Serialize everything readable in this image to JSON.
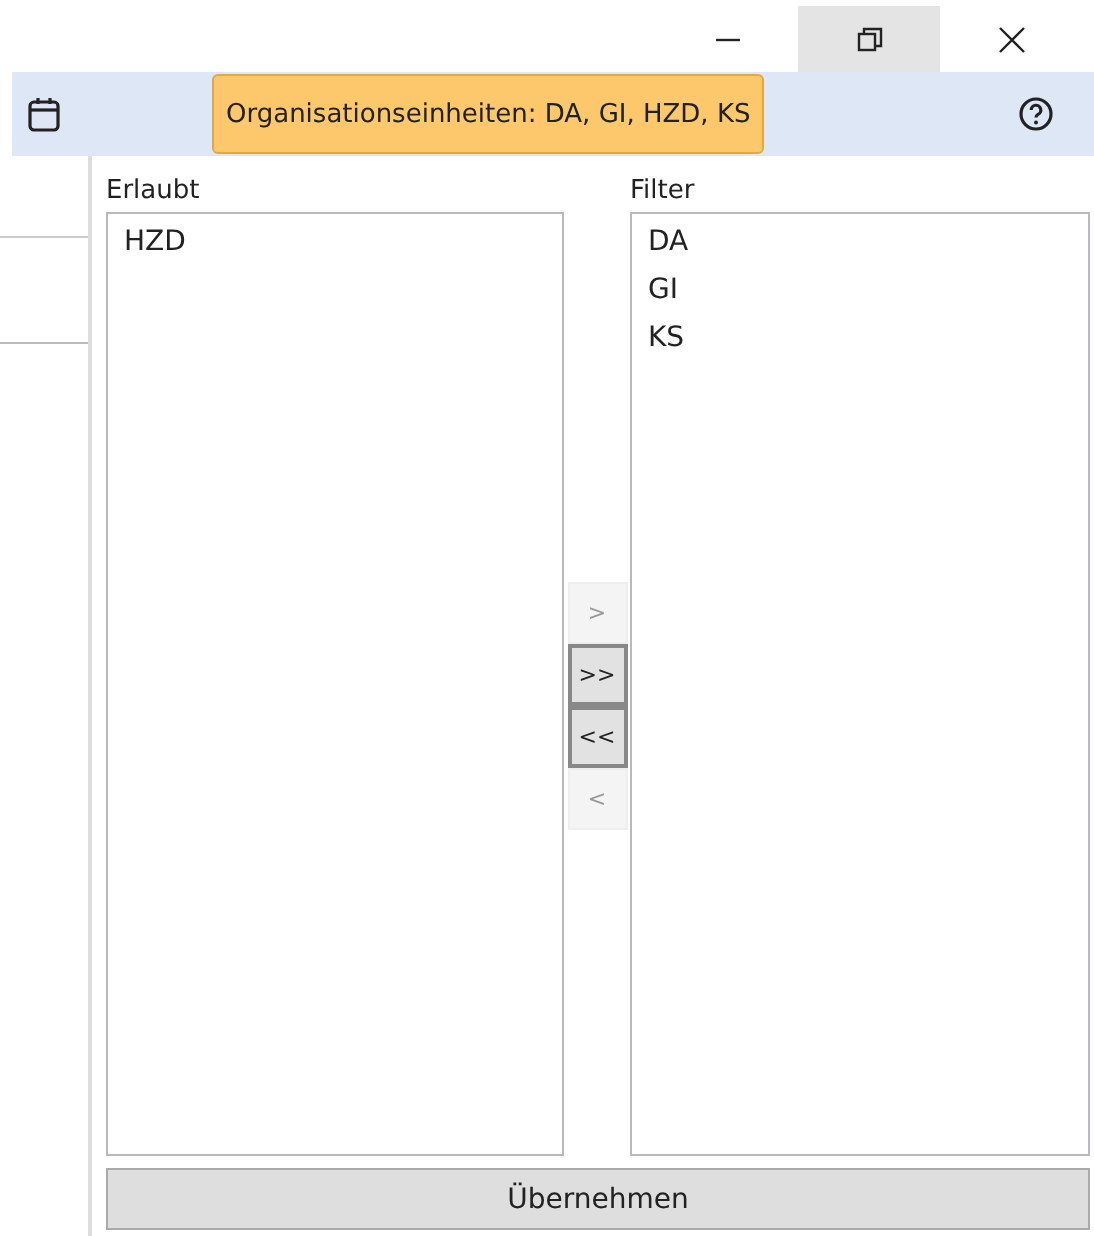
{
  "window_controls": [
    {
      "kind": "minimize",
      "highlighted": false
    },
    {
      "kind": "restore",
      "highlighted": true
    },
    {
      "kind": "close",
      "highlighted": false
    }
  ],
  "toolbar": {
    "filter_badge": "Organisationseinheiten: DA, GI, HZD, KS"
  },
  "allowed": {
    "label": "Erlaubt",
    "items": [
      "HZD"
    ]
  },
  "filter": {
    "label": "Filter",
    "items": [
      "DA",
      "GI",
      "KS"
    ]
  },
  "move_buttons": [
    {
      "label": ">",
      "disabled": true
    },
    {
      "label": ">>",
      "disabled": false
    },
    {
      "label": "<<",
      "disabled": false
    },
    {
      "label": "<",
      "disabled": true
    }
  ],
  "apply_button": "Übernehmen"
}
